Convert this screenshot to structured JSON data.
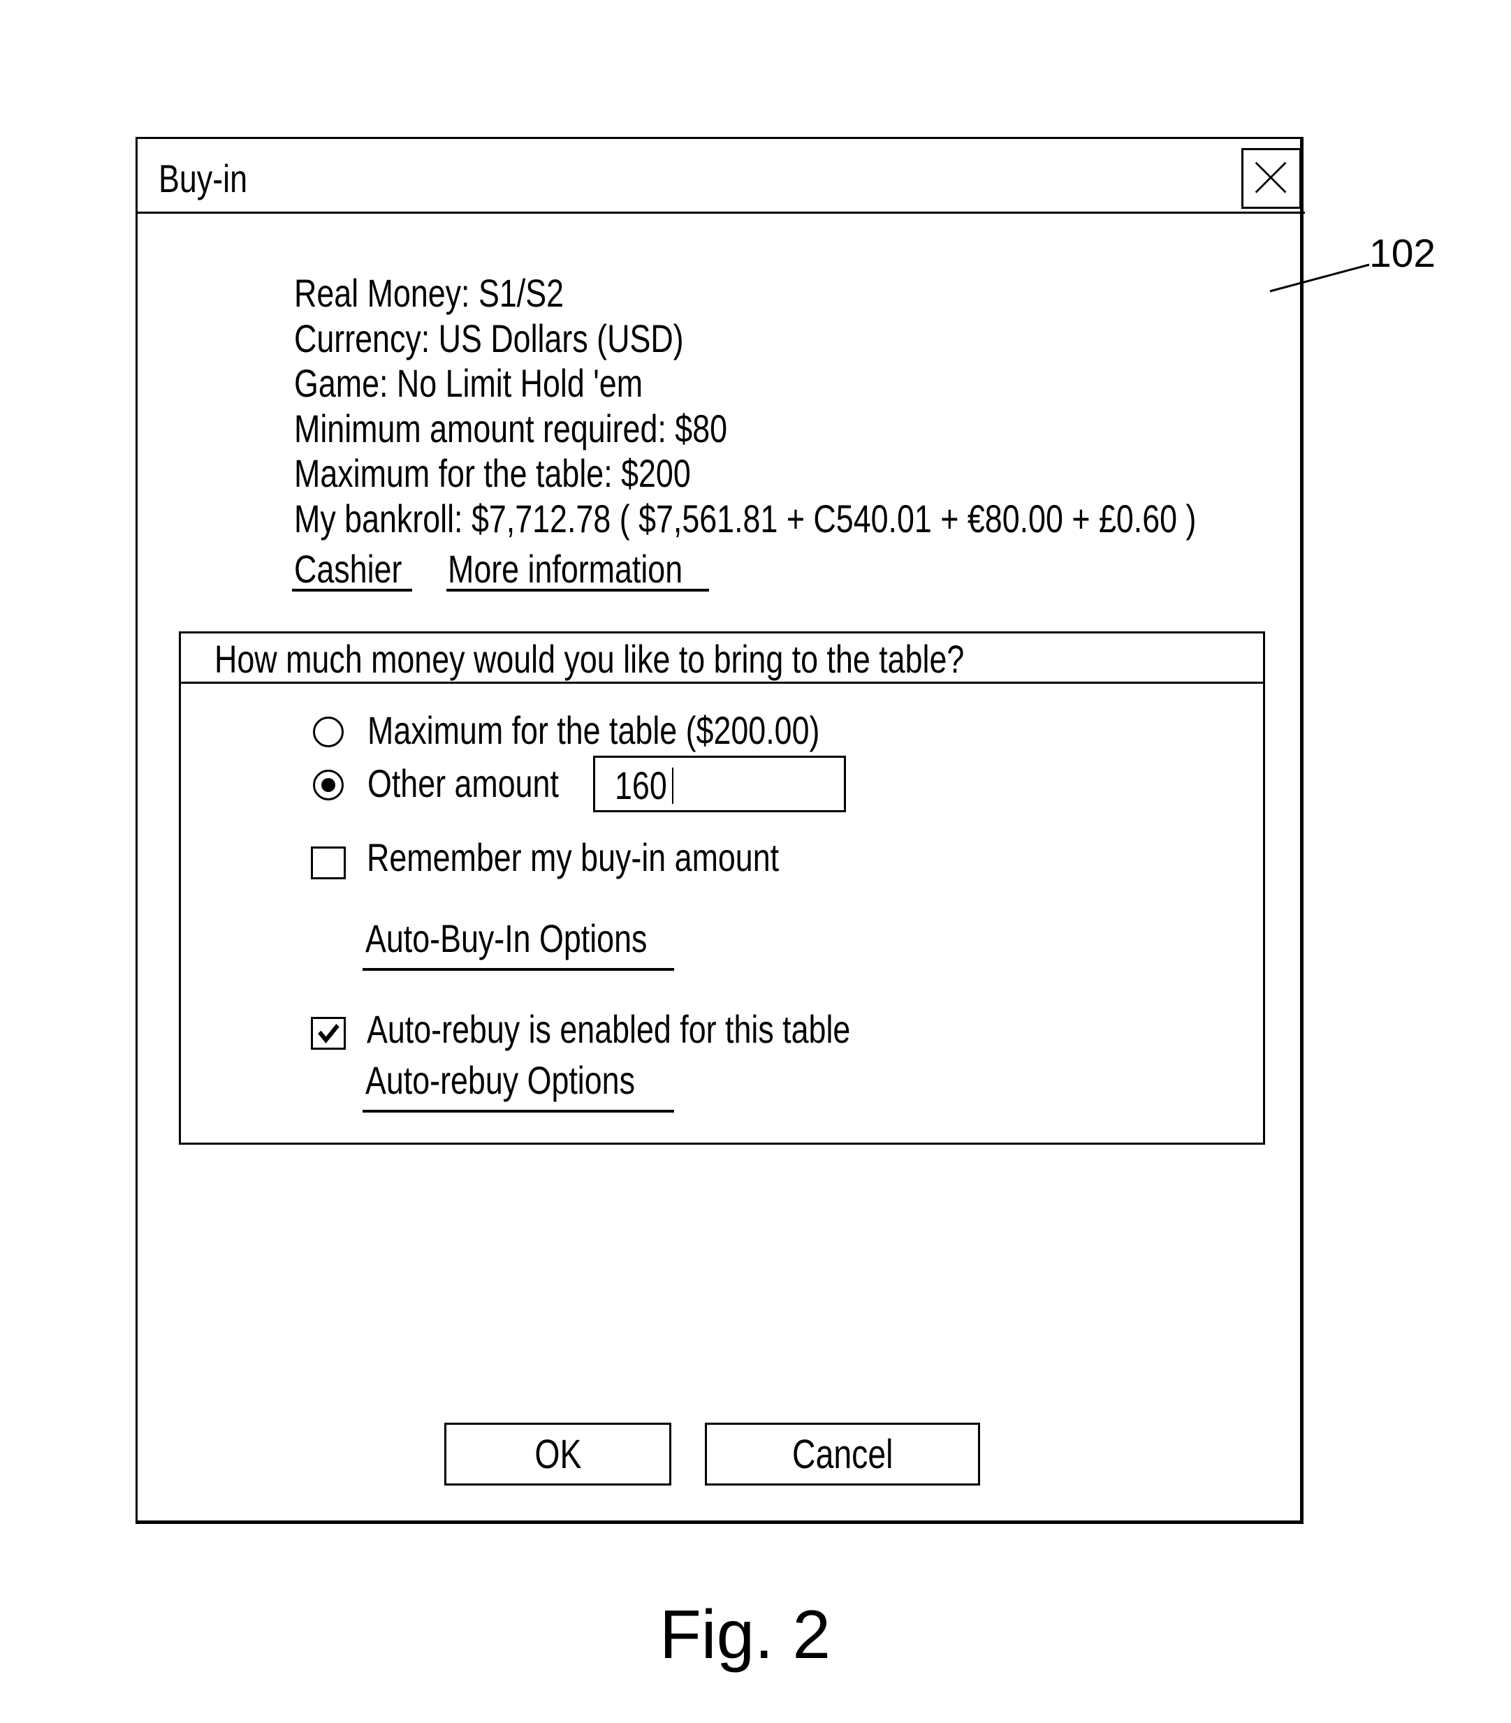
{
  "dialog": {
    "title": "Buy-in",
    "close_icon": "close-x-icon"
  },
  "info": {
    "lines": [
      "Real Money: S1/S2",
      "Currency: US Dollars (USD)",
      "Game: No Limit Hold 'em",
      "Minimum amount required: $80",
      "Maximum for the table: $200",
      "My bankroll: $7,712.78 ( $7,561.81 + C540.01 + €80.00 + £0.60 )"
    ],
    "links": {
      "cashier": "Cashier",
      "more_information": "More information"
    }
  },
  "buyin": {
    "question": "How much money would you like to bring to the table?",
    "options": [
      {
        "label": "Maximum for the table ($200.00)",
        "selected": false
      },
      {
        "label": "Other amount",
        "selected": true
      }
    ],
    "other_amount_value": "160",
    "remember": {
      "label": "Remember my buy-in amount",
      "checked": false
    },
    "auto_buyin_link": "Auto-Buy-In Options",
    "auto_rebuy": {
      "label": "Auto-rebuy is enabled for this table",
      "checked": true
    },
    "auto_rebuy_link": "Auto-rebuy Options"
  },
  "buttons": {
    "ok": "OK",
    "cancel": "Cancel"
  },
  "annotation": {
    "reference_numeral": "102",
    "figure_label": "Fig. 2"
  }
}
